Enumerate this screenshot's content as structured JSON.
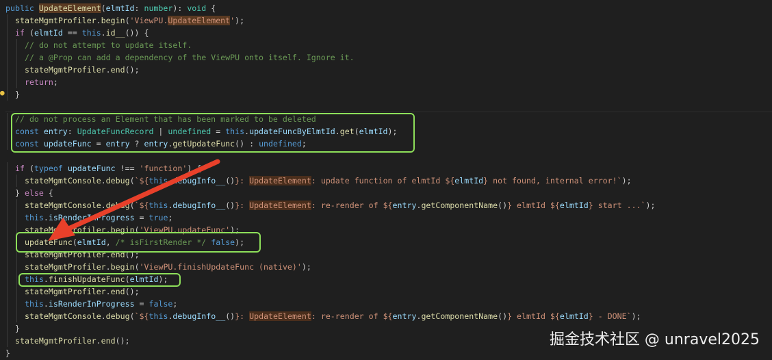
{
  "editor": {
    "lines": [
      [
        [
          "kw",
          "public "
        ],
        [
          "fn hl",
          "UpdateElement"
        ],
        [
          "pl",
          "("
        ],
        [
          "prop",
          "elmtId"
        ],
        [
          "pl",
          ": "
        ],
        [
          "ty",
          "number"
        ],
        [
          "pl",
          "): "
        ],
        [
          "ty",
          "void"
        ],
        [
          "pl",
          " {"
        ]
      ],
      [
        [
          "fn",
          "stateMgmtProfiler"
        ],
        [
          "pl",
          "."
        ],
        [
          "fn",
          "begin"
        ],
        [
          "pl",
          "("
        ],
        [
          "str",
          "'ViewPU."
        ],
        [
          "str hl",
          "UpdateElement"
        ],
        [
          "str",
          "'"
        ],
        [
          "pl",
          ");"
        ]
      ],
      [
        [
          "ctl",
          "if"
        ],
        [
          "pl",
          " ("
        ],
        [
          "prop",
          "elmtId"
        ],
        [
          "pl",
          " == "
        ],
        [
          "kw",
          "this"
        ],
        [
          "pl",
          "."
        ],
        [
          "fn",
          "id__"
        ],
        [
          "pl",
          "()) {"
        ]
      ],
      [
        [
          "cmt",
          "// do not attempt to update itself."
        ]
      ],
      [
        [
          "cmt",
          "// a @Prop can add a dependency of the ViewPU onto itself. Ignore it."
        ]
      ],
      [
        [
          "fn",
          "stateMgmtProfiler"
        ],
        [
          "pl",
          "."
        ],
        [
          "fn",
          "end"
        ],
        [
          "pl",
          "();"
        ]
      ],
      [
        [
          "ctl",
          "return"
        ],
        [
          "pl",
          ";"
        ]
      ],
      [
        [
          "pl",
          "}"
        ]
      ],
      [],
      [
        [
          "cmt",
          "// do not process an Element that has been marked to be deleted"
        ]
      ],
      [
        [
          "kw",
          "const "
        ],
        [
          "prop",
          "entry"
        ],
        [
          "pl",
          ": "
        ],
        [
          "ty",
          "UpdateFuncRecord"
        ],
        [
          "pl",
          " | "
        ],
        [
          "ty",
          "undefined"
        ],
        [
          "pl",
          " = "
        ],
        [
          "kw",
          "this"
        ],
        [
          "pl",
          "."
        ],
        [
          "prop",
          "updateFuncByElmtId"
        ],
        [
          "pl",
          "."
        ],
        [
          "fn",
          "get"
        ],
        [
          "pl",
          "("
        ],
        [
          "prop",
          "elmtId"
        ],
        [
          "pl",
          ");"
        ]
      ],
      [
        [
          "kw",
          "const "
        ],
        [
          "prop",
          "updateFunc"
        ],
        [
          "pl",
          " = "
        ],
        [
          "prop",
          "entry"
        ],
        [
          "pl",
          " ? "
        ],
        [
          "prop",
          "entry"
        ],
        [
          "pl",
          "."
        ],
        [
          "fn",
          "getUpdateFunc"
        ],
        [
          "pl",
          "() : "
        ],
        [
          "kw",
          "undefined"
        ],
        [
          "pl",
          ";"
        ]
      ],
      [],
      [
        [
          "ctl",
          "if"
        ],
        [
          "pl",
          " ("
        ],
        [
          "kw",
          "typeof "
        ],
        [
          "prop",
          "updateFunc"
        ],
        [
          "pl",
          " !== "
        ],
        [
          "str",
          "'function'"
        ],
        [
          "pl",
          ") {"
        ]
      ],
      [
        [
          "fn",
          "stateMgmtConsole"
        ],
        [
          "pl",
          "."
        ],
        [
          "fn",
          "debug"
        ],
        [
          "pl",
          "("
        ],
        [
          "str",
          "`${"
        ],
        [
          "kw",
          "this"
        ],
        [
          "pl",
          "."
        ],
        [
          "prop",
          "debugInfo__"
        ],
        [
          "pl",
          "()"
        ],
        [
          "str",
          "}: "
        ],
        [
          "str hlc",
          "UpdateElement"
        ],
        [
          "str",
          ": update function of elmtId ${"
        ],
        [
          "prop",
          "elmtId"
        ],
        [
          "str",
          "} not found, internal error!`"
        ],
        [
          "pl",
          ");"
        ]
      ],
      [
        [
          "pl",
          "} "
        ],
        [
          "ctl",
          "else"
        ],
        [
          "pl",
          " {"
        ]
      ],
      [
        [
          "fn",
          "stateMgmtConsole"
        ],
        [
          "pl",
          "."
        ],
        [
          "fn",
          "debug"
        ],
        [
          "pl",
          "("
        ],
        [
          "str",
          "`${"
        ],
        [
          "kw",
          "this"
        ],
        [
          "pl",
          "."
        ],
        [
          "prop",
          "debugInfo__"
        ],
        [
          "pl",
          "()"
        ],
        [
          "str",
          "}: "
        ],
        [
          "str hlc",
          "UpdateElement"
        ],
        [
          "str",
          ": re-render of ${"
        ],
        [
          "prop",
          "entry"
        ],
        [
          "pl",
          "."
        ],
        [
          "fn",
          "getComponentName"
        ],
        [
          "pl",
          "()"
        ],
        [
          "str",
          "} elmtId ${"
        ],
        [
          "prop",
          "elmtId"
        ],
        [
          "str",
          "} start ...`"
        ],
        [
          "pl",
          ");"
        ]
      ],
      [
        [
          "kw",
          "this"
        ],
        [
          "pl",
          "."
        ],
        [
          "prop",
          "isRenderInProgress"
        ],
        [
          "pl",
          " = "
        ],
        [
          "kw",
          "true"
        ],
        [
          "pl",
          ";"
        ]
      ],
      [
        [
          "fn",
          "stateMgmtProfiler"
        ],
        [
          "pl",
          "."
        ],
        [
          "fn",
          "begin"
        ],
        [
          "pl",
          "("
        ],
        [
          "str",
          "'ViewPU.updateFunc'"
        ],
        [
          "pl",
          ");"
        ]
      ],
      [
        [
          "fn",
          "updateFunc"
        ],
        [
          "pl",
          "("
        ],
        [
          "prop",
          "elmtId"
        ],
        [
          "pl",
          ", "
        ],
        [
          "cmt",
          "/* isFirstRender */"
        ],
        [
          "pl",
          " "
        ],
        [
          "kw",
          "false"
        ],
        [
          "pl",
          ");"
        ]
      ],
      [
        [
          "fn",
          "stateMgmtProfiler"
        ],
        [
          "pl",
          "."
        ],
        [
          "fn",
          "end"
        ],
        [
          "pl",
          "();"
        ]
      ],
      [
        [
          "fn",
          "stateMgmtProfiler"
        ],
        [
          "pl",
          "."
        ],
        [
          "fn",
          "begin"
        ],
        [
          "pl",
          "("
        ],
        [
          "str",
          "'ViewPU.finishUpdateFunc (native)'"
        ],
        [
          "pl",
          ");"
        ]
      ],
      [
        [
          "kw",
          "this"
        ],
        [
          "pl",
          "."
        ],
        [
          "fn",
          "finishUpdateFunc"
        ],
        [
          "pl",
          "("
        ],
        [
          "prop",
          "elmtId"
        ],
        [
          "pl",
          ");"
        ]
      ],
      [
        [
          "fn",
          "stateMgmtProfiler"
        ],
        [
          "pl",
          "."
        ],
        [
          "fn",
          "end"
        ],
        [
          "pl",
          "();"
        ]
      ],
      [
        [
          "kw",
          "this"
        ],
        [
          "pl",
          "."
        ],
        [
          "prop",
          "isRenderInProgress"
        ],
        [
          "pl",
          " = "
        ],
        [
          "kw",
          "false"
        ],
        [
          "pl",
          ";"
        ]
      ],
      [
        [
          "fn",
          "stateMgmtConsole"
        ],
        [
          "pl",
          "."
        ],
        [
          "fn",
          "debug"
        ],
        [
          "pl",
          "("
        ],
        [
          "str",
          "`${"
        ],
        [
          "kw",
          "this"
        ],
        [
          "pl",
          "."
        ],
        [
          "prop",
          "debugInfo__"
        ],
        [
          "pl",
          "()"
        ],
        [
          "str",
          "}: "
        ],
        [
          "str hlc",
          "UpdateElement"
        ],
        [
          "str",
          ": re-render of ${"
        ],
        [
          "prop",
          "entry"
        ],
        [
          "pl",
          "."
        ],
        [
          "fn",
          "getComponentName"
        ],
        [
          "pl",
          "()"
        ],
        [
          "str",
          "} elmtId ${"
        ],
        [
          "prop",
          "elmtId"
        ],
        [
          "str",
          "} - DONE`"
        ],
        [
          "pl",
          ");"
        ]
      ],
      [
        [
          "pl",
          "}"
        ]
      ],
      [
        [
          "fn",
          "stateMgmtProfiler"
        ],
        [
          "pl",
          "."
        ],
        [
          "fn",
          "end"
        ],
        [
          "pl",
          "();"
        ]
      ],
      [
        [
          "pl",
          "}"
        ]
      ]
    ],
    "indent": [
      0,
      1,
      1,
      2,
      2,
      2,
      2,
      1,
      0,
      1,
      1,
      1,
      0,
      1,
      2,
      1,
      2,
      2,
      2,
      2,
      2,
      2,
      2,
      2,
      2,
      2,
      1,
      1,
      0
    ]
  },
  "watermark": "掘金技术社区 @ unravel2025",
  "colors": {
    "box": "#8ee05a",
    "arrow": "#e8402a"
  }
}
